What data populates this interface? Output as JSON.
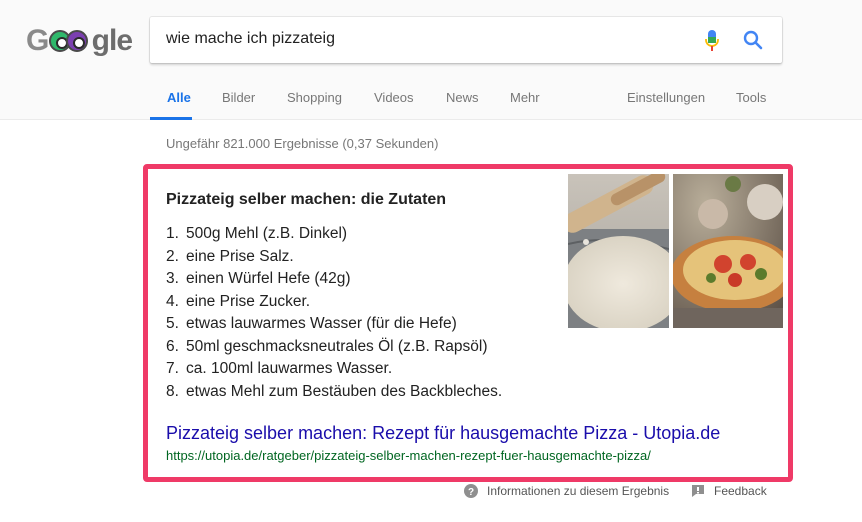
{
  "search": {
    "query": "wie mache ich pizzateig",
    "logo_text": "Google"
  },
  "tabs": [
    {
      "label": "Alle"
    },
    {
      "label": "Bilder"
    },
    {
      "label": "Shopping"
    },
    {
      "label": "Videos"
    },
    {
      "label": "News"
    },
    {
      "label": "Mehr"
    },
    {
      "label": "Einstellungen"
    },
    {
      "label": "Tools"
    }
  ],
  "result_stats": "Ungefähr 821.000 Ergebnisse (0,37 Sekunden)",
  "snippet": {
    "title": "Pizzateig selber machen: die Zutaten",
    "items": [
      {
        "num": "1.",
        "text": "500g Mehl (z.B. Dinkel)"
      },
      {
        "num": "2.",
        "text": "eine Prise Salz."
      },
      {
        "num": "3.",
        "text": "einen Würfel Hefe (42g)"
      },
      {
        "num": "4.",
        "text": "eine Prise Zucker."
      },
      {
        "num": "5.",
        "text": "etwas lauwarmes Wasser (für die Hefe)"
      },
      {
        "num": "6.",
        "text": "50ml geschmacksneutrales Öl (z.B. Rapsöl)"
      },
      {
        "num": "7.",
        "text": "ca. 100ml lauwarmes Wasser."
      },
      {
        "num": "8.",
        "text": "etwas Mehl zum Bestäuben des Backbleches."
      }
    ],
    "link_title": "Pizzateig selber machen: Rezept für hausgemachte Pizza - Utopia.de",
    "url": "https://utopia.de/ratgeber/pizzateig-selber-machen-rezept-fuer-hausgemachte-pizza/",
    "highlight_color": "#ef3a67"
  },
  "footer": {
    "info_label": "Informationen zu diesem Ergebnis",
    "feedback_label": "Feedback"
  },
  "colors": {
    "accent": "#1a73e8",
    "link": "#1a0dab",
    "url": "#006621"
  }
}
